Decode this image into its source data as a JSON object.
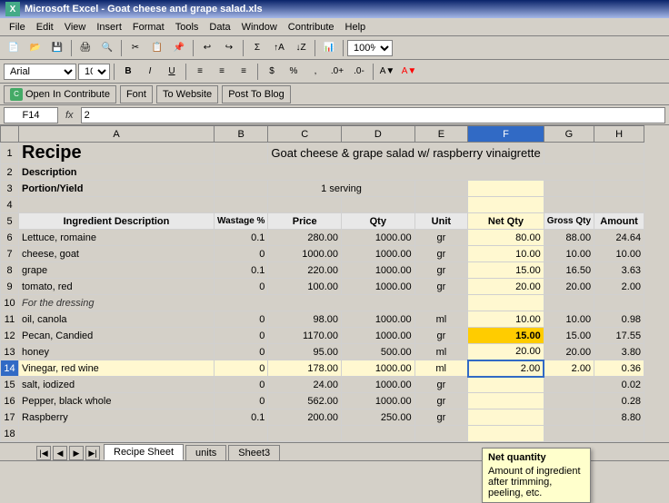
{
  "title_bar": {
    "title": "Microsoft Excel - Goat cheese and grape salad.xls"
  },
  "menu": {
    "items": [
      "File",
      "Edit",
      "View",
      "Insert",
      "Format",
      "Tools",
      "Data",
      "Window",
      "Contribute",
      "Help"
    ]
  },
  "contribute_toolbar": {
    "open_in_contribute": "Open In Contribute",
    "font": "Font",
    "to_website": "To Website",
    "post_to_blog": "Post To Blog"
  },
  "formula_bar": {
    "cell_ref": "F14",
    "formula": "2"
  },
  "spreadsheet": {
    "recipe_title": "Recipe",
    "recipe_name": "Goat cheese & grape salad w/ raspberry vinaigrette",
    "description_label": "Description",
    "portion_label": "Portion/Yield",
    "portion_value": "1 serving",
    "col_headers": [
      "A",
      "B",
      "C",
      "D",
      "E",
      "F",
      "G",
      "H"
    ],
    "col_labels": {
      "ingredient": "Ingredient Description",
      "wastage": "Wastage %",
      "price": "Price",
      "qty": "Qty",
      "unit": "Unit",
      "net_qty": "Net Qty",
      "gross_qty": "Gross Qty",
      "amount": "Amount"
    },
    "rows": [
      {
        "num": 6,
        "ingredient": "Lettuce, romaine",
        "wastage": "0.1",
        "price": "280.00",
        "qty": "1000.00",
        "unit": "gr",
        "net_qty": "80.00",
        "gross_qty": "88.00",
        "amount": "24.64"
      },
      {
        "num": 7,
        "ingredient": "cheese, goat",
        "wastage": "0",
        "price": "1000.00",
        "qty": "1000.00",
        "unit": "gr",
        "net_qty": "10.00",
        "gross_qty": "10.00",
        "amount": "10.00"
      },
      {
        "num": 8,
        "ingredient": "grape",
        "wastage": "0.1",
        "price": "220.00",
        "qty": "1000.00",
        "unit": "gr",
        "net_qty": "15.00",
        "gross_qty": "16.50",
        "amount": "3.63"
      },
      {
        "num": 9,
        "ingredient": "tomato, red",
        "wastage": "0",
        "price": "100.00",
        "qty": "1000.00",
        "unit": "gr",
        "net_qty": "20.00",
        "gross_qty": "20.00",
        "amount": "2.00"
      },
      {
        "num": 10,
        "ingredient": "For the dressing",
        "wastage": "",
        "price": "",
        "qty": "",
        "unit": "",
        "net_qty": "",
        "gross_qty": "",
        "amount": "",
        "section": true
      },
      {
        "num": 11,
        "ingredient": "oil, canola",
        "wastage": "0",
        "price": "98.00",
        "qty": "1000.00",
        "unit": "ml",
        "net_qty": "10.00",
        "gross_qty": "10.00",
        "amount": "0.98"
      },
      {
        "num": 12,
        "ingredient": "Pecan, Candied",
        "wastage": "0",
        "price": "1170.00",
        "qty": "1000.00",
        "unit": "gr",
        "net_qty": "15.00",
        "gross_qty": "15.00",
        "amount": "17.55"
      },
      {
        "num": 13,
        "ingredient": "honey",
        "wastage": "0",
        "price": "95.00",
        "qty": "500.00",
        "unit": "ml",
        "net_qty": "20.00",
        "gross_qty": "20.00",
        "amount": "3.80"
      },
      {
        "num": 14,
        "ingredient": "Vinegar, red wine",
        "wastage": "0",
        "price": "178.00",
        "qty": "1000.00",
        "unit": "ml",
        "net_qty": "2.00",
        "gross_qty": "2.00",
        "amount": "0.36",
        "active": true
      },
      {
        "num": 15,
        "ingredient": "salt, iodized",
        "wastage": "0",
        "price": "24.00",
        "qty": "1000.00",
        "unit": "gr",
        "net_qty": "",
        "gross_qty": "",
        "amount": "0.02"
      },
      {
        "num": 16,
        "ingredient": "Pepper, black whole",
        "wastage": "0",
        "price": "562.00",
        "qty": "1000.00",
        "unit": "gr",
        "net_qty": "",
        "gross_qty": "",
        "amount": "0.28"
      },
      {
        "num": 17,
        "ingredient": "Raspberry",
        "wastage": "0.1",
        "price": "200.00",
        "qty": "250.00",
        "unit": "gr",
        "net_qty": "",
        "gross_qty": "",
        "amount": "8.80"
      },
      {
        "num": 18,
        "ingredient": "",
        "wastage": "",
        "price": "",
        "qty": "",
        "unit": "",
        "net_qty": "",
        "gross_qty": "",
        "amount": ""
      }
    ],
    "tooltip": {
      "title": "Net quantity",
      "text": "Amount of ingredient after trimming, peeling, etc."
    }
  },
  "sheet_tabs": [
    "Recipe Sheet",
    "units",
    "Sheet3"
  ],
  "active_tab": "Recipe Sheet",
  "status_bar": ""
}
